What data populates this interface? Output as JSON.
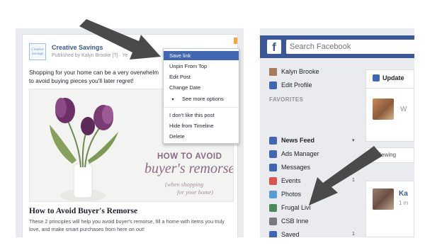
{
  "left": {
    "page_logo_lines": [
      "Creative",
      "Savings"
    ],
    "page_name": "Creative Savings",
    "post_meta": "Published by Kalyn Brooke [?] · Ye",
    "post_text_line1": "Shopping for your home can be a very overwhelm",
    "post_text_line2": "to avoid buying pieces you'll later regret!",
    "chevron": "⌄",
    "image": {
      "headline": "HOW TO AVOID",
      "script": "buyer's remorse",
      "sub1": "(when shopping",
      "sub2": "for your home)"
    },
    "link_title": "How to Avoid Buyer's Remorse",
    "link_desc": "These 2 principles will help you avoid buyer's remorse, fill a home with items you truly love, and make smart purchases from here on out!",
    "dropdown": {
      "save_link": "Save link",
      "unpin": "Unpin From Top",
      "edit_post": "Edit Post",
      "change_date": "Change Date",
      "more_arrow": "▼",
      "more": "See more options",
      "dont_like": "I don't like this post",
      "hide": "Hide from Timeline",
      "delete": "Delete"
    }
  },
  "right": {
    "logo": "f",
    "search_placeholder": "Search Facebook",
    "profile_name": "Kalyn Brooke",
    "edit_profile": "Edit Profile",
    "favorites_label": "FAVORITES",
    "nav": [
      {
        "label": "News Feed",
        "count": "▾"
      },
      {
        "label": "Ads Manager",
        "count": ""
      },
      {
        "label": "Messages",
        "count": ""
      },
      {
        "label": "Events",
        "count": "1"
      },
      {
        "label": "Photos",
        "count": ""
      },
      {
        "label": "Frugal Livi",
        "count": ""
      },
      {
        "label": "CSB Inne",
        "count": ""
      },
      {
        "label": "Saved",
        "count": "1"
      }
    ],
    "nav_icon_colors": [
      "#4267b2",
      "#4267b2",
      "#4267b2",
      "#d9534f",
      "#5b9bd5",
      "#4a8a5a",
      "#7a7a7a",
      "#4267b2"
    ],
    "update_label": "Update",
    "update_letter": "W",
    "viewing_text": "◷ Viewing ",
    "story_name": "Ka",
    "story_time": "1 m"
  },
  "colors": {
    "facebook_blue": "#3b5998",
    "highlight": "#4267b2",
    "arrow": "#4a4a4a"
  }
}
